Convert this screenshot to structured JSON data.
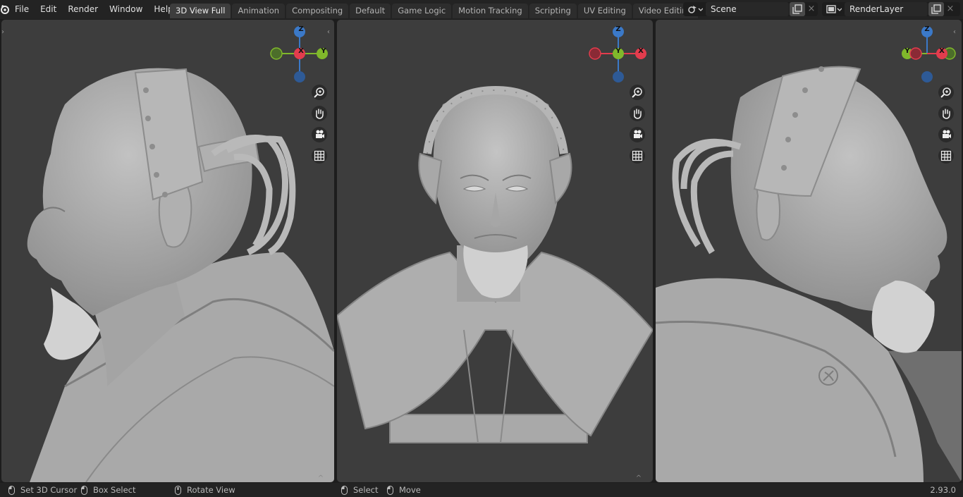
{
  "menu": [
    "File",
    "Edit",
    "Render",
    "Window",
    "Help"
  ],
  "workspace_tabs": [
    {
      "label": "3D View Full",
      "active": true
    },
    {
      "label": "Animation",
      "active": false
    },
    {
      "label": "Compositing",
      "active": false
    },
    {
      "label": "Default",
      "active": false
    },
    {
      "label": "Game Logic",
      "active": false
    },
    {
      "label": "Motion Tracking",
      "active": false
    },
    {
      "label": "Scripting",
      "active": false
    },
    {
      "label": "UV Editing",
      "active": false
    },
    {
      "label": "Video Editing",
      "active": false
    }
  ],
  "add_tab_label": "+",
  "scene": {
    "value": "Scene",
    "clear": "×"
  },
  "view_layer": {
    "value": "RenderLayer",
    "clear": "×"
  },
  "viewports": [
    {
      "gizmo": {
        "top": "Z",
        "left": "",
        "center": "X",
        "right": "Y"
      },
      "orientation": "left"
    },
    {
      "gizmo": {
        "top": "Z",
        "left": "",
        "center": "Y",
        "right": "X"
      },
      "orientation": "front"
    },
    {
      "gizmo": {
        "top": "Z",
        "left": "Y",
        "center": "",
        "right": "X"
      },
      "orientation": "right"
    }
  ],
  "nav_tools": [
    "zoom-icon",
    "hand-pan-icon",
    "camera-icon",
    "grid-icon"
  ],
  "status": {
    "hints": [
      "Set 3D Cursor",
      "Box Select",
      "Rotate View",
      "Select",
      "Move"
    ],
    "version": "2.93.0"
  },
  "colors": {
    "x_axis": "#e33c4d",
    "y_axis": "#80b82b",
    "z_axis": "#3b79c8",
    "viewport_bg": "#3d3d3d",
    "header_bg": "#232323"
  }
}
